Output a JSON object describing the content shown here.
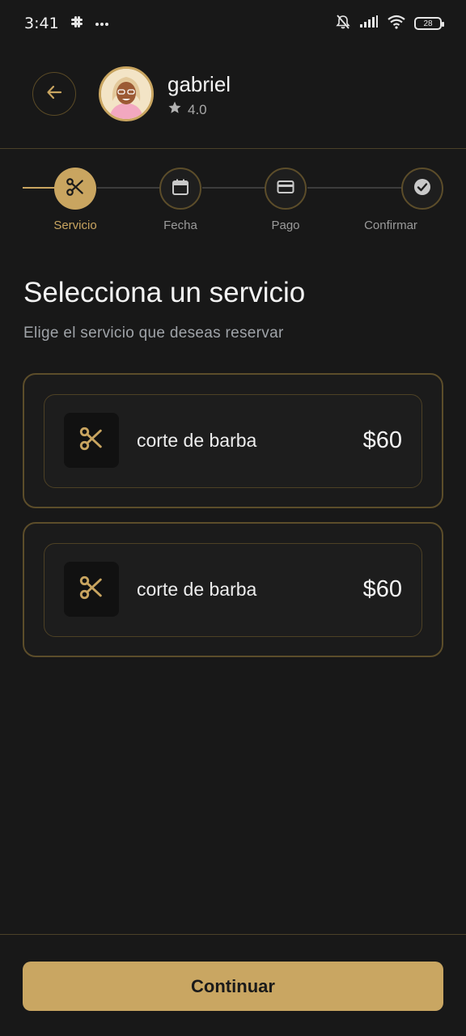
{
  "status_bar": {
    "time": "3:41",
    "battery": "28",
    "icons": [
      "slack-icon",
      "more-icon",
      "mute-icon",
      "signal-icon",
      "wifi-icon",
      "battery-icon"
    ]
  },
  "header": {
    "profile_name": "gabriel",
    "rating": "4.0"
  },
  "stepper": {
    "steps": [
      {
        "label": "Servicio",
        "icon": "scissors-icon",
        "state": "active"
      },
      {
        "label": "Fecha",
        "icon": "calendar-icon",
        "state": "inactive"
      },
      {
        "label": "Pago",
        "icon": "credit-card-icon",
        "state": "inactive"
      },
      {
        "label": "Confirmar",
        "icon": "check-circle-icon",
        "state": "inactive"
      }
    ]
  },
  "main": {
    "title": "Selecciona un servicio",
    "subtitle": "Elige el servicio que deseas reservar",
    "services": [
      {
        "name": "corte de barba",
        "price": "$60"
      },
      {
        "name": "corte de barba",
        "price": "$60"
      }
    ]
  },
  "footer": {
    "continue_label": "Continuar"
  },
  "colors": {
    "accent": "#c9a560",
    "background": "#181818",
    "border": "#5c4d2a"
  }
}
